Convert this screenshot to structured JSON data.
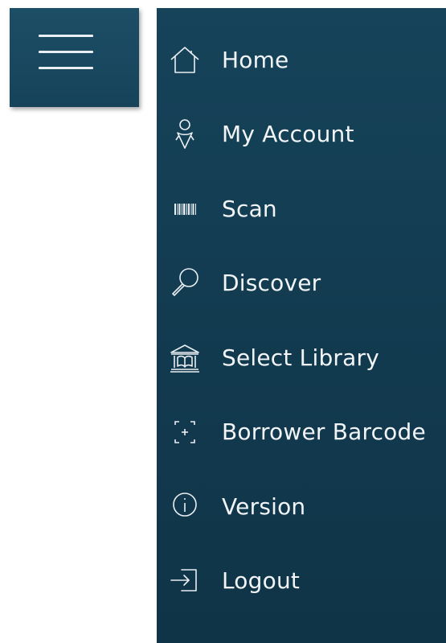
{
  "colors": {
    "panel_bg": "#16435a",
    "text": "#f2f5f7",
    "page_bg": "#ffffff"
  },
  "menu_button": {
    "icon": "hamburger-icon"
  },
  "menu": {
    "items": [
      {
        "label": "Home",
        "icon": "home-icon"
      },
      {
        "label": "My Account",
        "icon": "account-icon"
      },
      {
        "label": "Scan",
        "icon": "barcode-icon"
      },
      {
        "label": "Discover",
        "icon": "search-icon"
      },
      {
        "label": "Select Library",
        "icon": "library-icon"
      },
      {
        "label": "Borrower Barcode",
        "icon": "scan-frame-icon"
      },
      {
        "label": "Version",
        "icon": "info-icon"
      },
      {
        "label": "Logout",
        "icon": "logout-icon"
      }
    ]
  }
}
